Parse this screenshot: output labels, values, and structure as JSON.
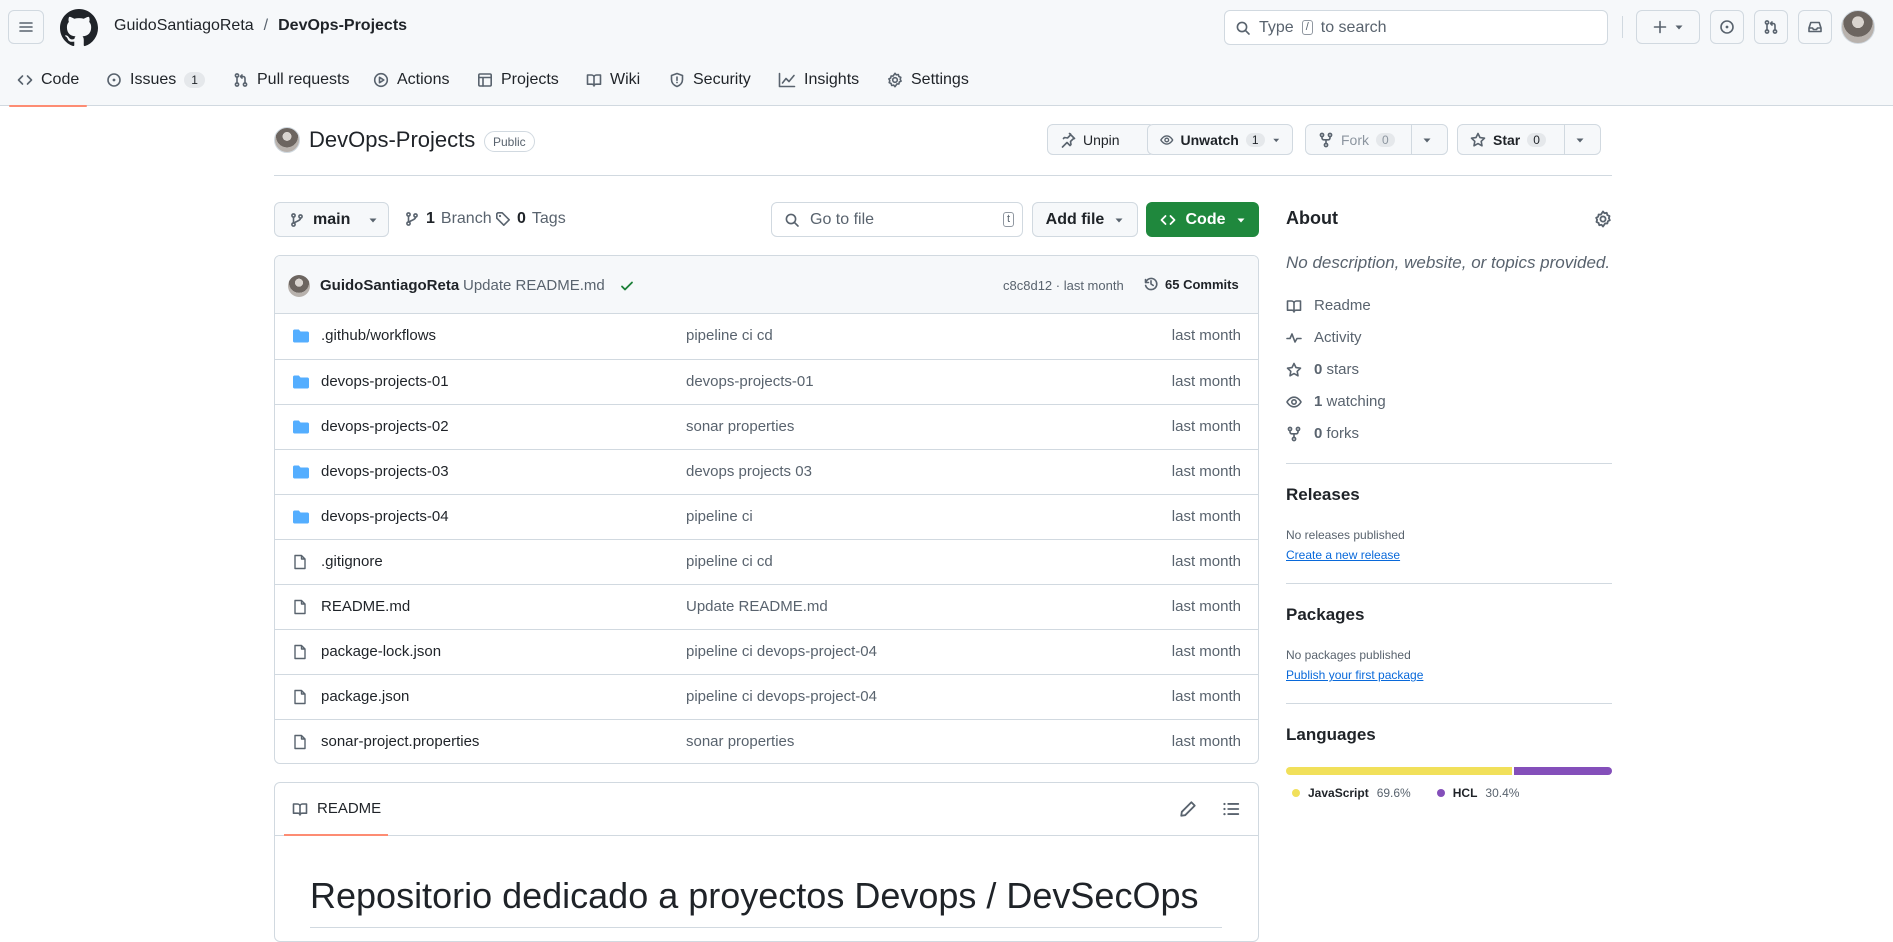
{
  "header": {
    "owner": "GuidoSantiagoReta",
    "separator": "/",
    "repo": "DevOps-Projects",
    "search_placeholder_pre": "Type",
    "search_key": "/",
    "search_placeholder_post": "to search"
  },
  "tabs": [
    {
      "label": "Code",
      "icon": "code-icon",
      "active": true
    },
    {
      "label": "Issues",
      "icon": "issue-icon",
      "count": "1"
    },
    {
      "label": "Pull requests",
      "icon": "pull-request-icon"
    },
    {
      "label": "Actions",
      "icon": "play-icon"
    },
    {
      "label": "Projects",
      "icon": "table-icon"
    },
    {
      "label": "Wiki",
      "icon": "book-icon"
    },
    {
      "label": "Security",
      "icon": "shield-icon"
    },
    {
      "label": "Insights",
      "icon": "graph-icon"
    },
    {
      "label": "Settings",
      "icon": "gear-icon"
    }
  ],
  "repo": {
    "name": "DevOps-Projects",
    "visibility": "Public",
    "unpin": "Unpin",
    "unwatch": "Unwatch",
    "watch_count": "1",
    "fork": "Fork",
    "fork_count": "0",
    "star": "Star",
    "star_count": "0"
  },
  "branch_bar": {
    "branch": "main",
    "branch_count": "1",
    "branch_label": "Branch",
    "tag_count": "0",
    "tag_label": "Tags",
    "goto_placeholder": "Go to file",
    "goto_key": "t",
    "add_file": "Add file",
    "code": "Code"
  },
  "latest_commit": {
    "author": "GuidoSantiagoReta",
    "message": "Update README.md",
    "sha_time": "c8c8d12 · last month",
    "commits": "65 Commits"
  },
  "files": [
    {
      "name": ".github/workflows",
      "type": "folder",
      "message": "pipeline ci cd",
      "date": "last month"
    },
    {
      "name": "devops-projects-01",
      "type": "folder",
      "message": "devops-projects-01",
      "date": "last month"
    },
    {
      "name": "devops-projects-02",
      "type": "folder",
      "message": "sonar properties",
      "date": "last month"
    },
    {
      "name": "devops-projects-03",
      "type": "folder",
      "message": "devops projects 03",
      "date": "last month"
    },
    {
      "name": "devops-projects-04",
      "type": "folder",
      "message": "pipeline ci",
      "date": "last month"
    },
    {
      "name": ".gitignore",
      "type": "file",
      "message": "pipeline ci cd",
      "date": "last month"
    },
    {
      "name": "README.md",
      "type": "file",
      "message": "Update README.md",
      "date": "last month"
    },
    {
      "name": "package-lock.json",
      "type": "file",
      "message": "pipeline ci devops-project-04",
      "date": "last month"
    },
    {
      "name": "package.json",
      "type": "file",
      "message": "pipeline ci devops-project-04",
      "date": "last month"
    },
    {
      "name": "sonar-project.properties",
      "type": "file",
      "message": "sonar properties",
      "date": "last month"
    }
  ],
  "readme": {
    "tab": "README",
    "heading": "Repositorio dedicado a proyectos Devops / DevSecOps"
  },
  "about": {
    "title": "About",
    "description": "No description, website, or topics provided.",
    "readme": "Readme",
    "activity": "Activity",
    "stars_count": "0",
    "stars_label": "stars",
    "watching_count": "1",
    "watching_label": "watching",
    "forks_count": "0",
    "forks_label": "forks"
  },
  "releases": {
    "title": "Releases",
    "none": "No releases published",
    "link": "Create a new release"
  },
  "packages": {
    "title": "Packages",
    "none": "No packages published",
    "link": "Publish your first package"
  },
  "languages": {
    "title": "Languages",
    "items": [
      {
        "name": "JavaScript",
        "percent": "69.6%",
        "value": 69.6,
        "color": "#f1e05a"
      },
      {
        "name": "HCL",
        "percent": "30.4%",
        "value": 30.4,
        "color": "#844fba"
      }
    ]
  },
  "colors": {
    "accent_underline": "#fd8c73",
    "code_button": "#1f883d",
    "folder": "#54aeff",
    "link": "#0969da"
  }
}
